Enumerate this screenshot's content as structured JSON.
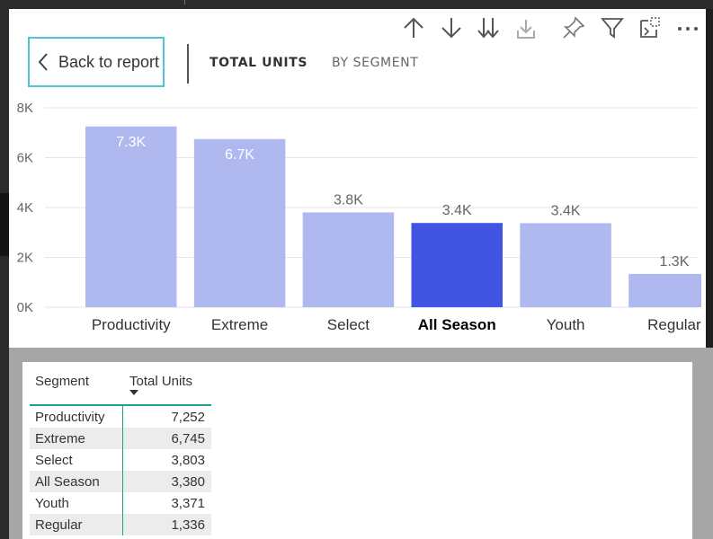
{
  "header": {
    "back_label": "Back to report",
    "tabs": [
      {
        "label": "TOTAL UNITS",
        "active": true
      },
      {
        "label": "BY SEGMENT",
        "active": false
      }
    ]
  },
  "toolbar": {
    "icons": [
      "sort-ascending-icon",
      "sort-descending-icon",
      "drill-down-icon",
      "expand-hierarchy-icon",
      "pin-icon",
      "filter-icon",
      "export-icon",
      "more-options-icon"
    ]
  },
  "colors": {
    "bar_default": "#b0b8f0",
    "bar_highlight": "#4155e2",
    "accent_border": "#4fc3d8",
    "table_rule": "#1aa38a"
  },
  "chart_data": {
    "type": "bar",
    "categories": [
      "Productivity",
      "Extreme",
      "Select",
      "All Season",
      "Youth",
      "Regular"
    ],
    "values": [
      7252,
      6745,
      3803,
      3380,
      3371,
      1336
    ],
    "data_labels": [
      "7.3K",
      "6.7K",
      "3.8K",
      "3.4K",
      "3.4K",
      "1.3K"
    ],
    "highlighted_category": "All Season",
    "ylim": [
      0,
      8000
    ],
    "y_ticks": [
      0,
      2000,
      4000,
      6000,
      8000
    ],
    "y_tick_labels": [
      "0K",
      "2K",
      "4K",
      "6K",
      "8K"
    ],
    "grid": true,
    "title": "",
    "xlabel": "",
    "ylabel": ""
  },
  "table": {
    "headers": [
      "Segment",
      "Total Units"
    ],
    "rows": [
      [
        "Productivity",
        "7,252"
      ],
      [
        "Extreme",
        "6,745"
      ],
      [
        "Select",
        "3,803"
      ],
      [
        "All Season",
        "3,380"
      ],
      [
        "Youth",
        "3,371"
      ],
      [
        "Regular",
        "1,336"
      ]
    ]
  }
}
